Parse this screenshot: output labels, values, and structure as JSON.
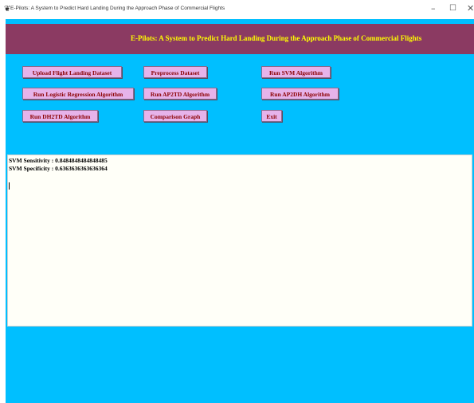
{
  "window": {
    "title": "E-Pilots: A System to Predict Hard Landing During the Approach Phase of Commercial Flights",
    "icon": "feather-icon",
    "controls": {
      "minimize": "–",
      "maximize": "☐",
      "close": "✕"
    }
  },
  "header": {
    "title": "E-Pilots: A System to Predict Hard Landing During the Approach Phase of Commercial Flights"
  },
  "buttons": {
    "upload": "Upload Flight Landing Dataset",
    "preprocess": "Preprocess Dataset",
    "svm": "Run SVM Algorithm",
    "logistic": "Run Logistic Regression Algorithm",
    "ap2td": "Run AP2TD Algorithm",
    "ap2dh": "Run AP2DH Algorithm",
    "dh2td": "Run DH2TD Algorithm",
    "graph": "Comparison Graph",
    "exit": "Exit"
  },
  "output": {
    "lines": [
      "SVM Sensitivity : 0.8484848484848485",
      "SVM Specificity : 0.6363636363636364"
    ]
  },
  "colors": {
    "background": "#00bfff",
    "header_bg": "#8b3a62",
    "header_text": "#ffff00",
    "button_bg": "#e6b3ea",
    "button_text": "#8b0000"
  }
}
